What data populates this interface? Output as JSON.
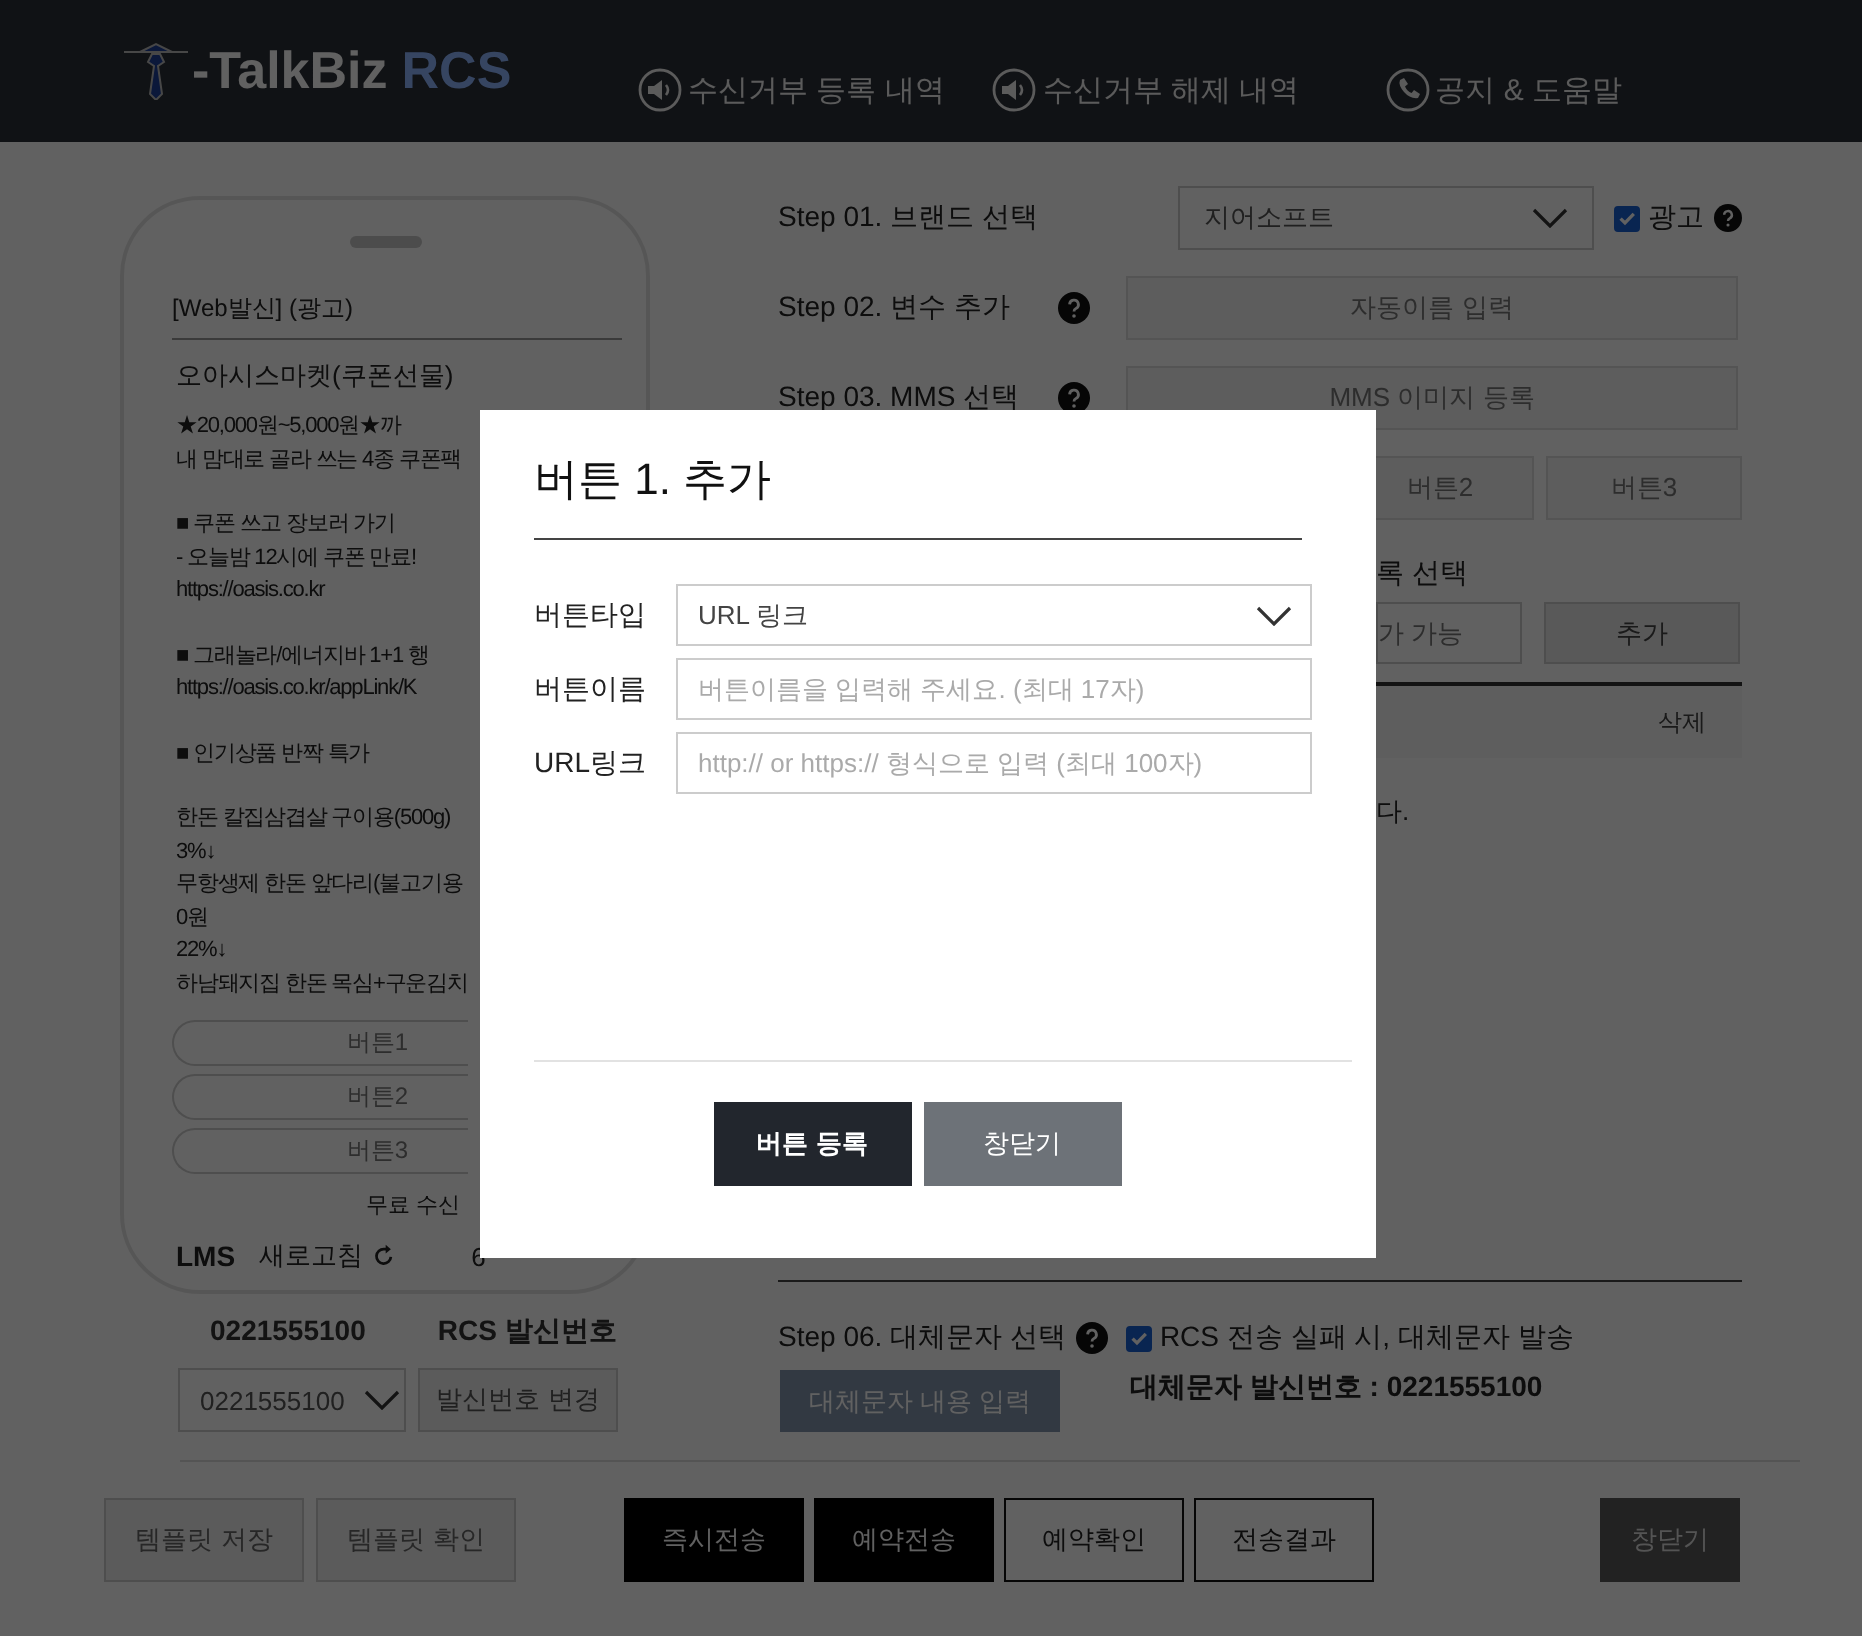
{
  "header": {
    "logo_text": "-TalkBiz",
    "logo_accent": "RCS",
    "nav": [
      {
        "kind": "speaker",
        "label": "수신거부 등록 내역"
      },
      {
        "kind": "speaker",
        "label": "수신거부 해제 내역"
      },
      {
        "kind": "phone",
        "label": "공지 & 도움말"
      }
    ]
  },
  "preview": {
    "heading": "[Web발신] (광고)",
    "title": "오아시스마켓(쿠폰선물)",
    "paragraphs": [
      [
        "★20,000원~5,000원★까",
        "내 맘대로 골라 쓰는 4종 쿠폰팩"
      ],
      [
        "■ 쿠폰 쓰고 장보러 가기",
        "- 오늘밤 12시에 쿠폰 만료!",
        "https://oasis.co.kr"
      ],
      [
        "■ 그래놀라/에너지바 1+1 행",
        "https://oasis.co.kr/appLink/K"
      ],
      [
        "■ 인기상품 반짝 특가"
      ],
      [
        "한돈 칼집삼겹살 구이용(500g)",
        "3%↓",
        "무항생제 한돈 앞다리(불고기용",
        "0원",
        "22%↓",
        "하남돼지집 한돈 목심+구운김치"
      ]
    ],
    "buttons": [
      "버튼1",
      "버튼2",
      "버튼3"
    ],
    "optout": "무료 수신",
    "type": "LMS",
    "refresh": "새로고침",
    "count": "6"
  },
  "sender": {
    "number": "0221555100",
    "label": "RCS 발신번호",
    "select_value": "0221555100",
    "change_button": "발신번호 변경"
  },
  "step01": {
    "label": "Step 01. 브랜드 선택",
    "brand": "지어소프트",
    "ad_checked": true,
    "ad_label": "광고"
  },
  "step02": {
    "label": "Step 02. 변수 추가",
    "button": "자동이름 입력"
  },
  "step03": {
    "label": "Step 03. MMS 선택",
    "button": "MMS 이미지 등록"
  },
  "step04": {
    "buttons": [
      "버튼2",
      "버튼3"
    ]
  },
  "step05": {
    "label_fragment": "록 선택",
    "input_fragment": "가 가능",
    "add_button": "추가",
    "delete_header": "삭제",
    "note_fragment": "다."
  },
  "step06": {
    "label": "Step 06. 대체문자 선택",
    "fallback_checked": true,
    "fallback_label": "RCS 전송 실패 시, 대체문자 발송",
    "content_button": "대체문자 내용 입력",
    "sender_info": "대체문자 발신번호 : 0221555100"
  },
  "footer_buttons": [
    {
      "label": "템플릿 저장",
      "kind": "light"
    },
    {
      "label": "템플릿 확인",
      "kind": "light"
    },
    {
      "label": "즉시전송",
      "kind": "dark"
    },
    {
      "label": "예약전송",
      "kind": "dark"
    },
    {
      "label": "예약확인",
      "kind": "outline"
    },
    {
      "label": "전송결과",
      "kind": "outline"
    },
    {
      "label": "창닫기",
      "kind": "close"
    }
  ],
  "modal": {
    "title": "버튼 1. 추가",
    "fields": [
      {
        "kind": "select",
        "label": "버튼타입",
        "value": "URL 링크"
      },
      {
        "kind": "input",
        "label": "버튼이름",
        "placeholder": "버튼이름을 입력해 주세요. (최대 17자)"
      },
      {
        "kind": "input",
        "label": "URL링크",
        "placeholder": "http:// or https:// 형식으로 입력 (최대 100자)"
      }
    ],
    "buttons": [
      {
        "label": "버튼 등록",
        "kind": "primary"
      },
      {
        "label": "창닫기",
        "kind": "secondary"
      }
    ]
  }
}
